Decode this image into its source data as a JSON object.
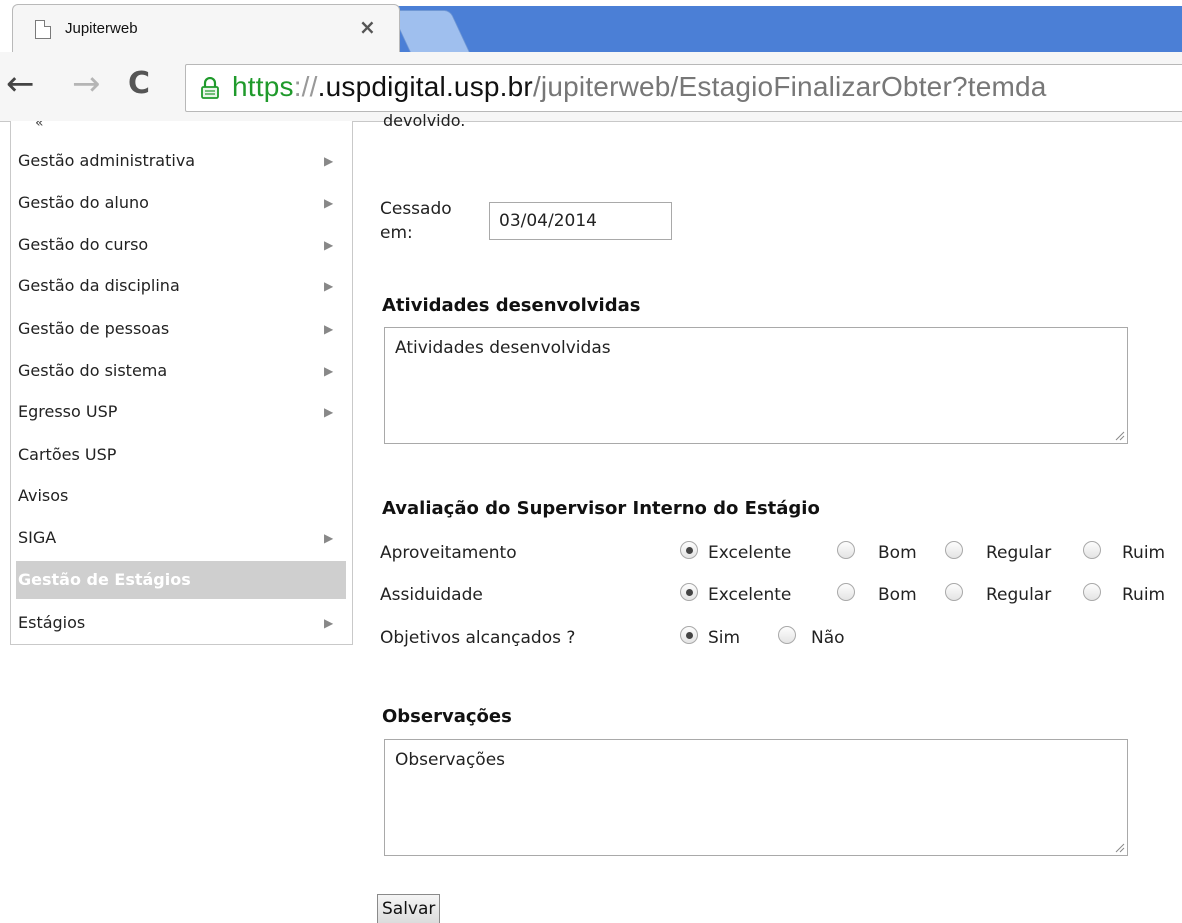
{
  "browser": {
    "tab_title": "Jupiterweb",
    "tab_close": "×",
    "back": "←",
    "forward": "→",
    "reload": "C",
    "url_scheme": "https",
    "url_sep": "://",
    "url_host": ".uspdigital.usp.br",
    "url_path": "/jupiterweb/EstagioFinalizarObter?temda"
  },
  "sidebar": {
    "top_cut": "«",
    "items": [
      {
        "label": "Gestão administrativa",
        "arrow": "▶"
      },
      {
        "label": "Gestão do aluno",
        "arrow": "▶"
      },
      {
        "label": "Gestão do curso",
        "arrow": "▶"
      },
      {
        "label": "Gestão da disciplina",
        "arrow": "▶"
      },
      {
        "label": "Gestão de pessoas",
        "arrow": "▶"
      },
      {
        "label": "Gestão do sistema",
        "arrow": "▶"
      },
      {
        "label": "Egresso USP",
        "arrow": "▶"
      },
      {
        "label": "Cartões USP",
        "arrow": ""
      },
      {
        "label": "Avisos",
        "arrow": ""
      },
      {
        "label": "SIGA",
        "arrow": "▶"
      },
      {
        "label": "Gestão de Estágios",
        "arrow": "",
        "active": true
      },
      {
        "label": "Estágios",
        "arrow": "▶"
      }
    ]
  },
  "main": {
    "cut_text": "devolvido.",
    "ceased_label_1": "Cessado",
    "ceased_label_2": "em:",
    "ceased_value": "03/04/2014",
    "activities_title": "Atividades desenvolvidas",
    "activities_value": "Atividades desenvolvidas",
    "evaluation_title": "Avaliação do Supervisor Interno do Estágio",
    "rows": [
      {
        "label": "Aproveitamento",
        "options": [
          "Excelente",
          "Bom",
          "Regular",
          "Ruim"
        ],
        "selected": 0
      },
      {
        "label": "Assiduidade",
        "options": [
          "Excelente",
          "Bom",
          "Regular",
          "Ruim"
        ],
        "selected": 0
      },
      {
        "label": "Objetivos alcançados ?",
        "options": [
          "Sim",
          "Não"
        ],
        "selected": 0
      }
    ],
    "observations_title": "Observações",
    "observations_value": "Observações",
    "save_label": "Salvar"
  }
}
